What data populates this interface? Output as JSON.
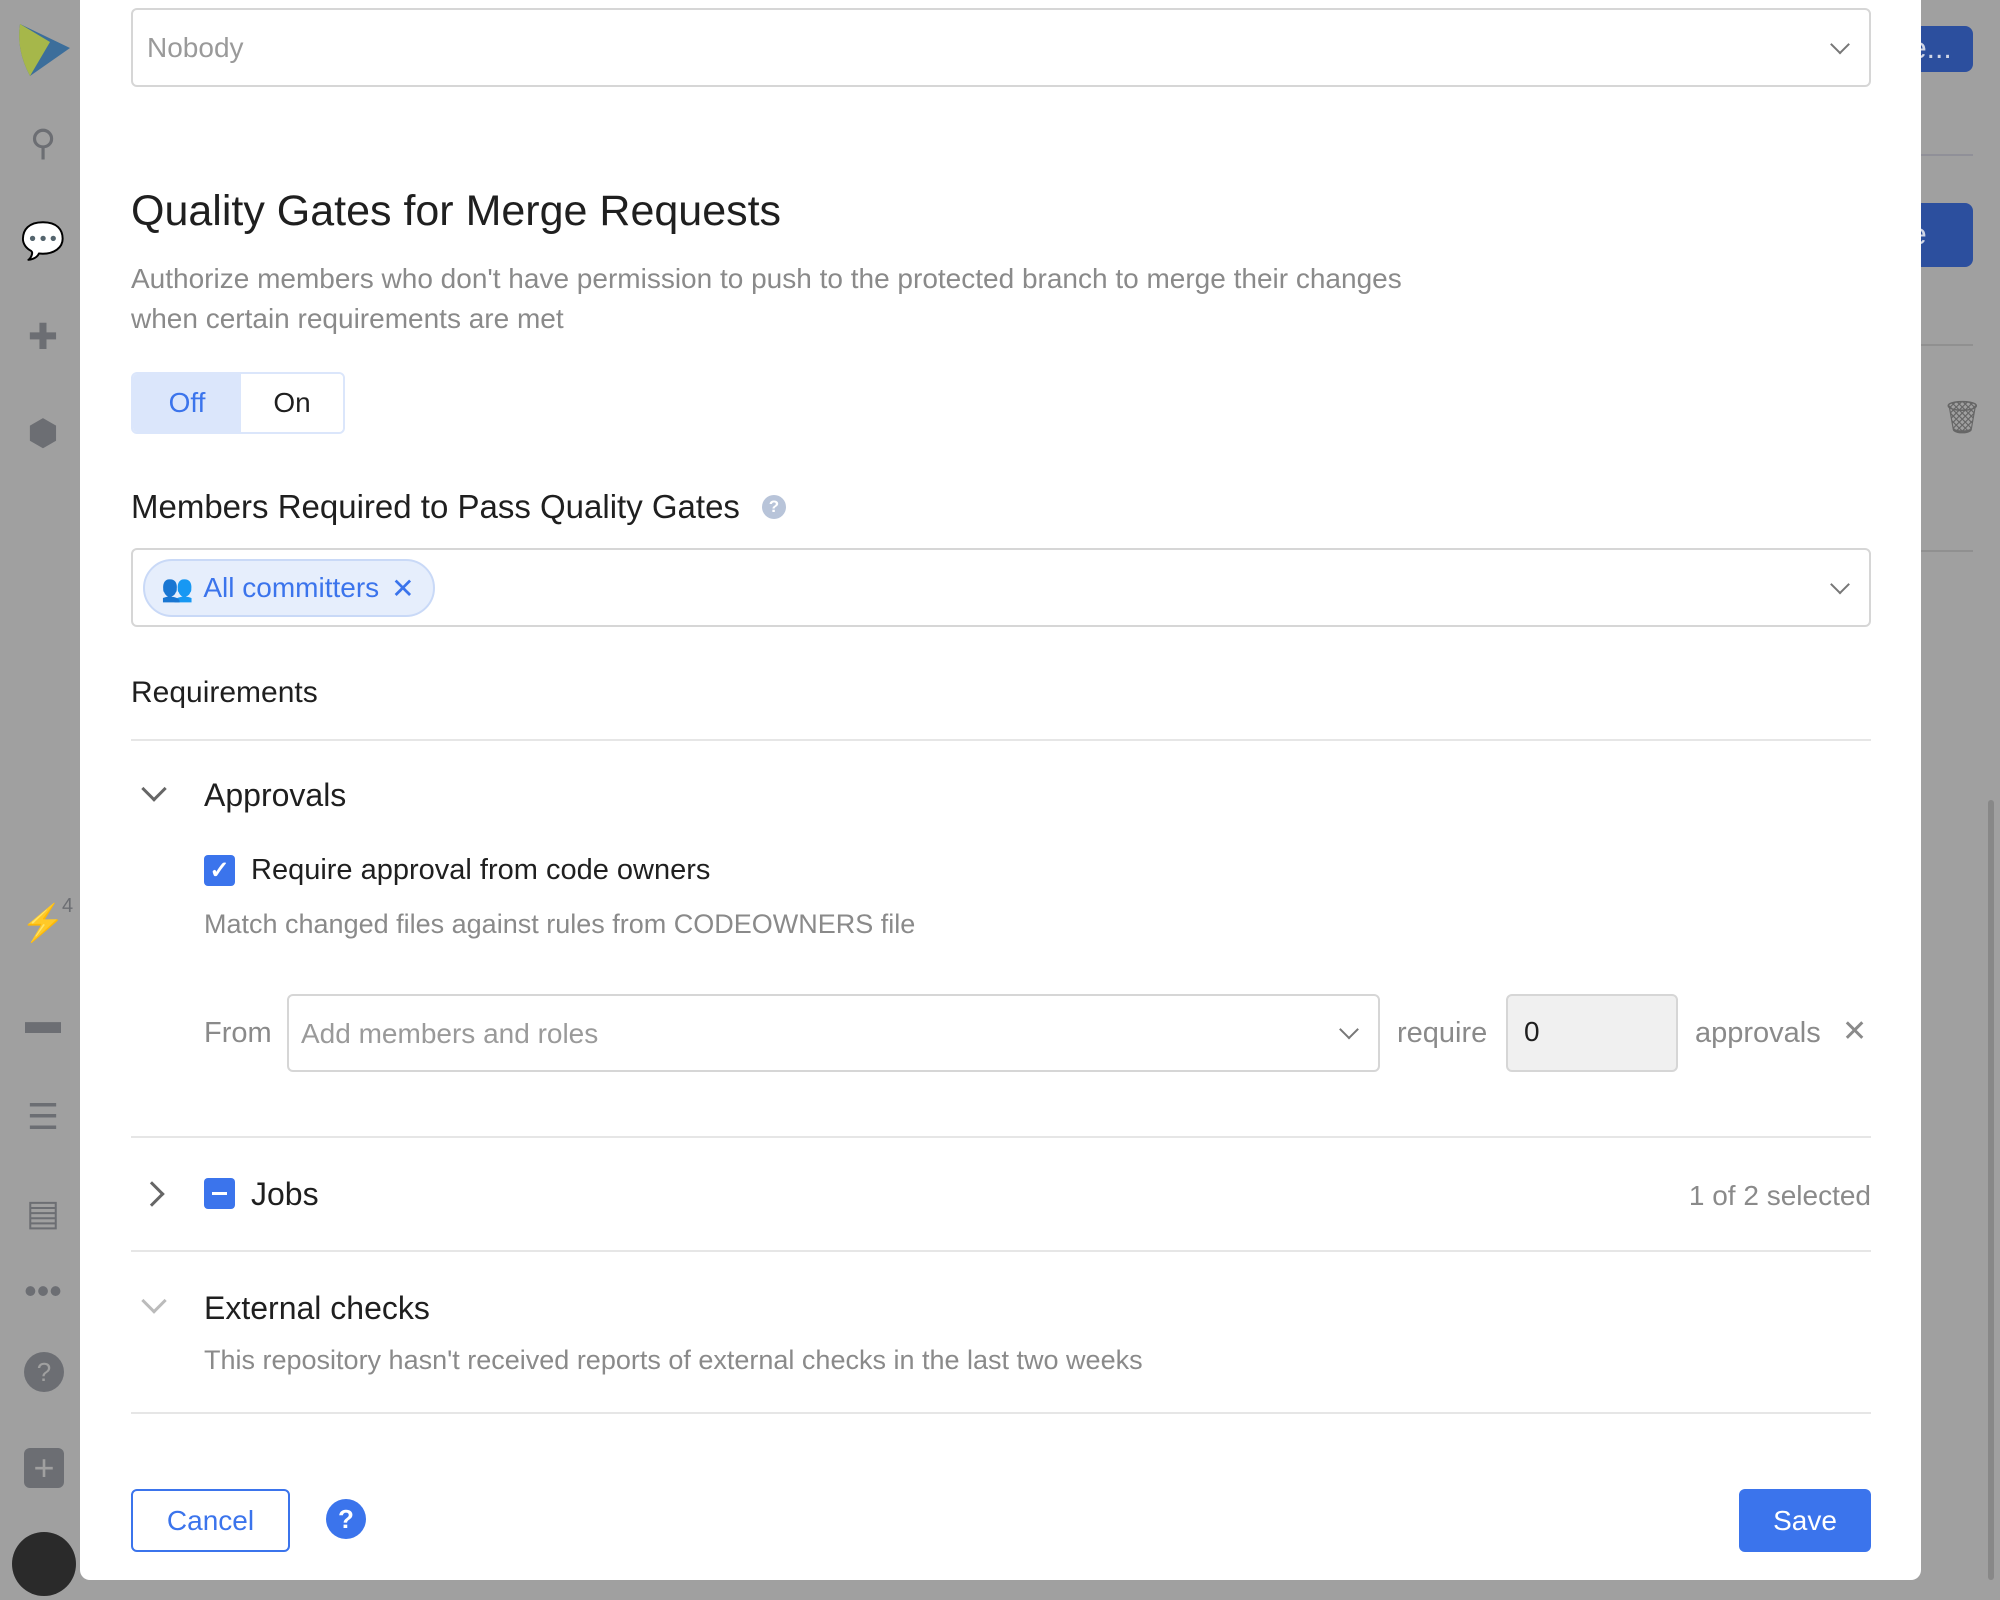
{
  "background": {
    "button_top_label": "e...",
    "button_mid_label": "e"
  },
  "modal": {
    "top_select": {
      "value": "Nobody"
    },
    "title": "Quality Gates for Merge Requests",
    "description_line1": "Authorize members who don't have permission to push to the protected branch to merge their changes",
    "description_line2": "when certain requirements are met",
    "toggle": {
      "off": "Off",
      "on": "On",
      "selected": "Off"
    },
    "members_label": "Members Required to Pass Quality Gates",
    "members_chip": "All committers",
    "requirements_label": "Requirements",
    "approvals": {
      "label": "Approvals",
      "checkbox_label": "Require approval from code owners",
      "checked": true,
      "hint": "Match changed files against rules from CODEOWNERS file",
      "from_label": "From",
      "from_placeholder": "Add members and roles",
      "require_label": "require",
      "count": "0",
      "approvals_label": "approvals"
    },
    "jobs": {
      "label": "Jobs",
      "status": "1 of 2 selected"
    },
    "external": {
      "label": "External checks",
      "hint": "This repository hasn't received reports of external checks in the last two weeks"
    },
    "cancel": "Cancel",
    "help": "?",
    "save": "Save"
  },
  "sidebar": {
    "notifications_badge": "4",
    "help": "?"
  },
  "colors": {
    "accent": "#3b74ec",
    "overlay": "#a0a0a0"
  }
}
